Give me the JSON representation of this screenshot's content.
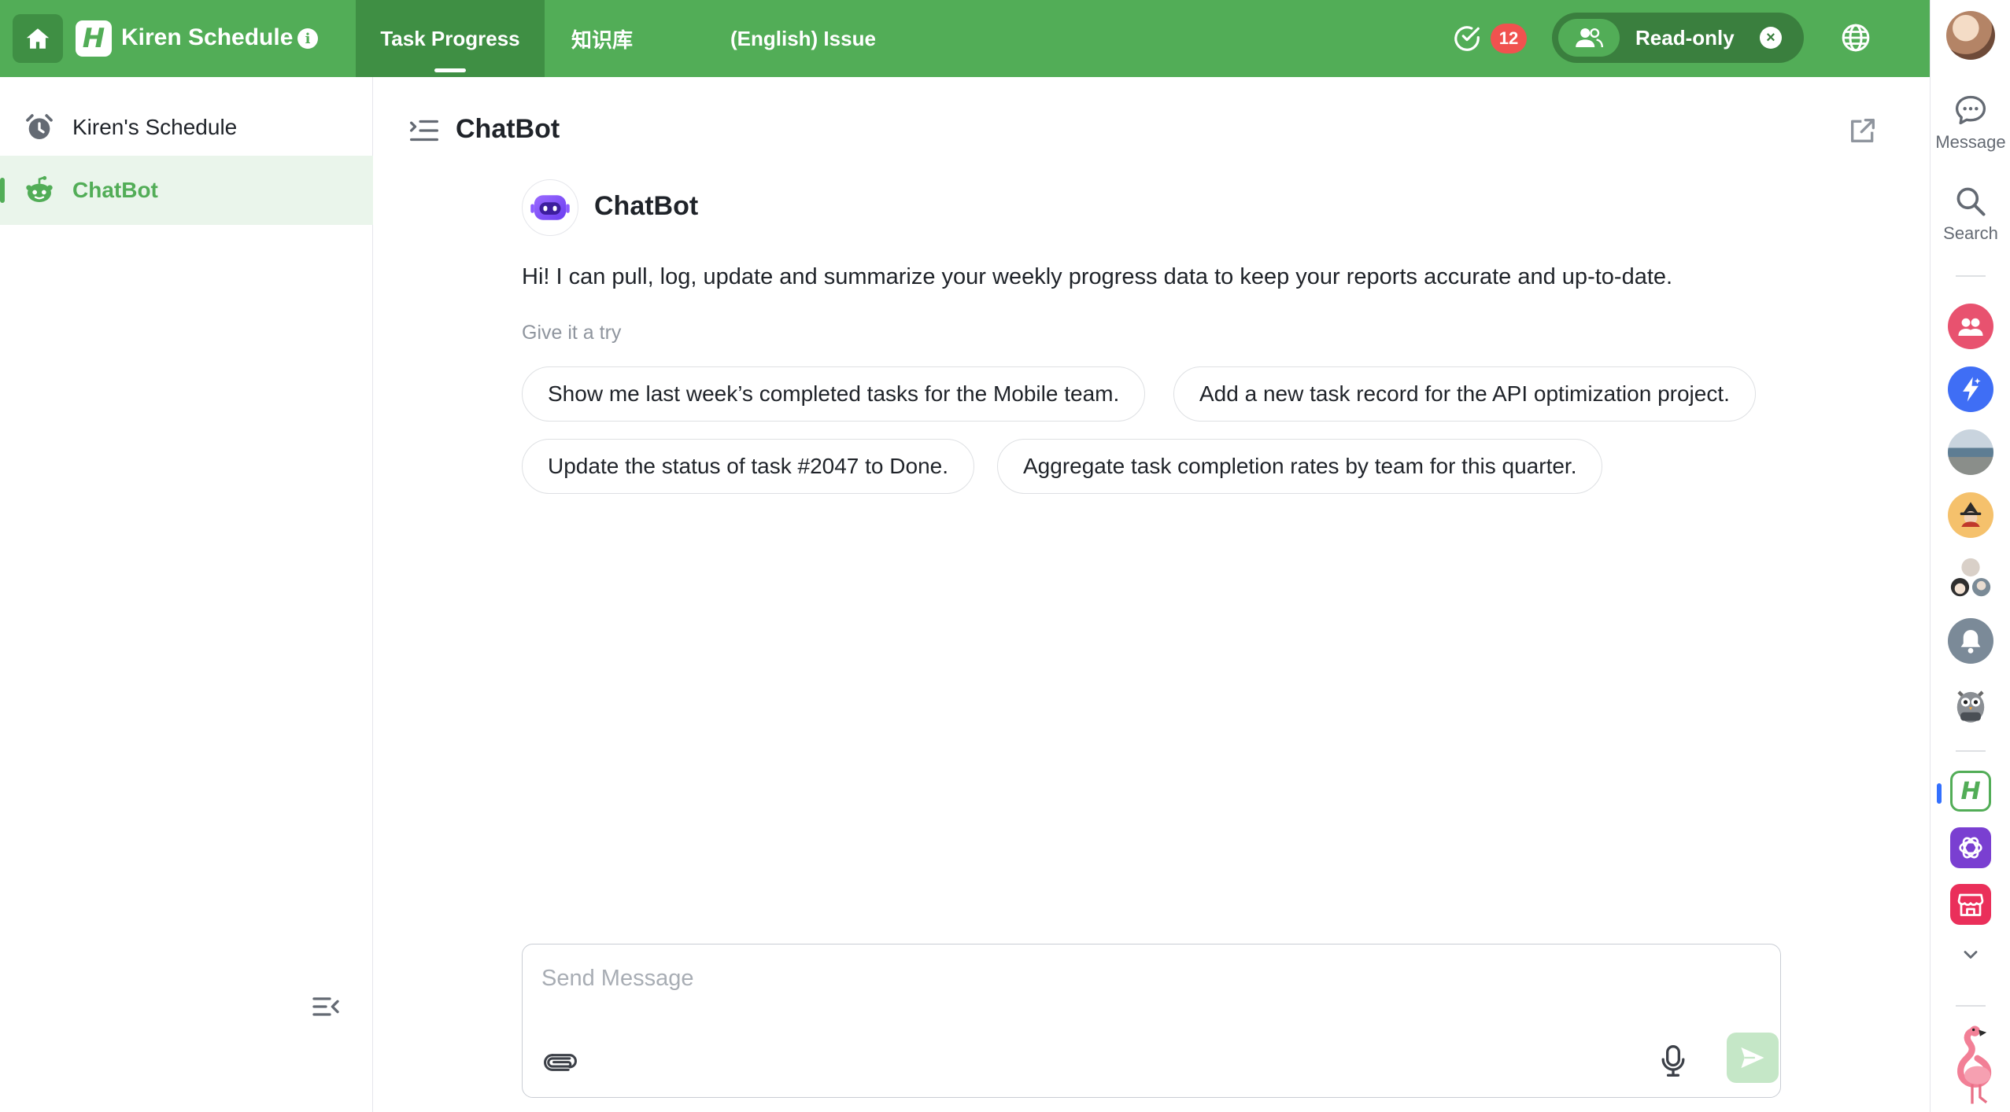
{
  "header": {
    "app_name": "Kiren Schedule",
    "logo_letter": "H",
    "tabs": [
      {
        "label": "Task Progress",
        "active": true
      },
      {
        "label": "知识库",
        "active": false
      },
      {
        "label": "(English) Issue",
        "active": false
      }
    ],
    "task_badge_count": "12",
    "permission_label": "Read-only"
  },
  "sidebar": {
    "items": [
      {
        "label": "Kiren's Schedule",
        "icon": "alarm-clock-icon",
        "active": false
      },
      {
        "label": "ChatBot",
        "icon": "bot-icon",
        "active": true
      }
    ]
  },
  "main": {
    "title": "ChatBot",
    "bot": {
      "name": "ChatBot",
      "intro": "Hi! I can pull, log, update and summarize your weekly progress data to keep your reports accurate and up-to-date.",
      "try_label": "Give it a try",
      "suggestions": [
        "Show me last week’s completed tasks for the Mobile team.",
        "Add a new task record for the API optimization project.",
        "Update the status of task #2047 to Done.",
        "Aggregate task completion rates by team for this quarter."
      ]
    },
    "composer": {
      "placeholder": "Send Message"
    }
  },
  "rail": {
    "message_label": "Message",
    "search_label": "Search",
    "app_logo_letter": "H"
  },
  "colors": {
    "brand_green": "#52ad57",
    "dark_green": "#3f8f44",
    "badge_red": "#f0524f"
  }
}
